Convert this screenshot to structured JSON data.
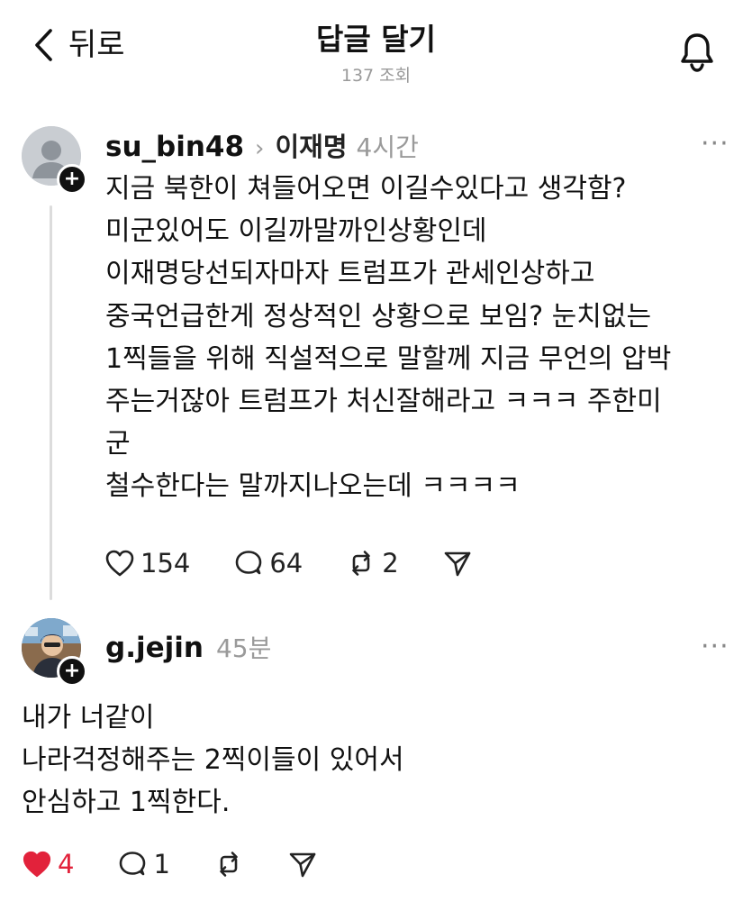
{
  "header": {
    "back_label": "뒤로",
    "title": "답글 달기",
    "views": "137 조회"
  },
  "posts": [
    {
      "username": "su_bin48",
      "separator": "›",
      "reply_to": "이재명",
      "time": "4시간",
      "more": "···",
      "lines": [
        "지금 북한이 쳐들어오면 이길수있다고 생각함?",
        "미군있어도 이길까말까인상황인데",
        "이재명당선되자마자 트럼프가 관세인상하고",
        "중국언급한게 정상적인 상황으로 보임? 눈치없는",
        "1찍들을 위해 직설적으로 말할께 지금 무언의 압박",
        "주는거잖아 트럼프가 처신잘해라고 ㅋㅋㅋ 주한미",
        "군",
        "철수한다는 말까지나오는데 ㅋㅋㅋㅋ"
      ],
      "likes": "154",
      "comments": "64",
      "reposts": "2",
      "liked": false
    },
    {
      "username": "g.jejin",
      "time": "45분",
      "more": "···",
      "lines": [
        "내가 너같이",
        "나라걱정해주는 2찍이들이 있어서",
        "안심하고 1찍한다."
      ],
      "likes": "4",
      "comments": "1",
      "liked": true
    }
  ],
  "colors": {
    "like_active": "#e2223b",
    "muted": "#9a9a9a",
    "thread_line": "#dcdcdc"
  },
  "icons": [
    "chevron-left-icon",
    "bell-icon",
    "more-icon",
    "heart-icon",
    "comment-icon",
    "repost-icon",
    "share-icon",
    "plus-icon"
  ]
}
